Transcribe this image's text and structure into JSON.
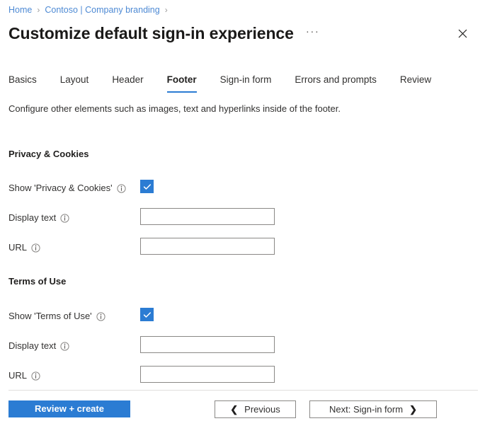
{
  "breadcrumb": {
    "items": [
      {
        "label": "Home"
      },
      {
        "label": "Contoso | Company branding"
      }
    ],
    "separator": "›"
  },
  "header": {
    "title": "Customize default sign-in experience",
    "more_label": "···",
    "close_icon": "close-icon"
  },
  "tabs": [
    {
      "label": "Basics",
      "active": false
    },
    {
      "label": "Layout",
      "active": false
    },
    {
      "label": "Header",
      "active": false
    },
    {
      "label": "Footer",
      "active": true
    },
    {
      "label": "Sign-in form",
      "active": false
    },
    {
      "label": "Errors and prompts",
      "active": false
    },
    {
      "label": "Review",
      "active": false
    }
  ],
  "description": "Configure other elements such as images, text and hyperlinks inside of the footer.",
  "sections": [
    {
      "heading": "Privacy & Cookies",
      "toggle_label": "Show 'Privacy & Cookies'",
      "toggle_checked": true,
      "display_text_label": "Display text",
      "display_text_value": "",
      "display_text_placeholder": "",
      "url_label": "URL",
      "url_value": "",
      "url_placeholder": ""
    },
    {
      "heading": "Terms of Use",
      "toggle_label": "Show 'Terms of Use'",
      "toggle_checked": true,
      "display_text_label": "Display text",
      "display_text_value": "",
      "display_text_placeholder": "",
      "url_label": "URL",
      "url_value": "",
      "url_placeholder": ""
    }
  ],
  "footer_bar": {
    "review_create_label": "Review + create",
    "previous_label": "Previous",
    "next_label": "Next: Sign-in form",
    "previous_chevron": "❮",
    "next_chevron": "❯"
  },
  "colors": {
    "accent": "#2b7cd3",
    "link": "#4e8ad4",
    "text": "#323130",
    "border": "#8a8886",
    "divider": "#e1dfdd"
  }
}
